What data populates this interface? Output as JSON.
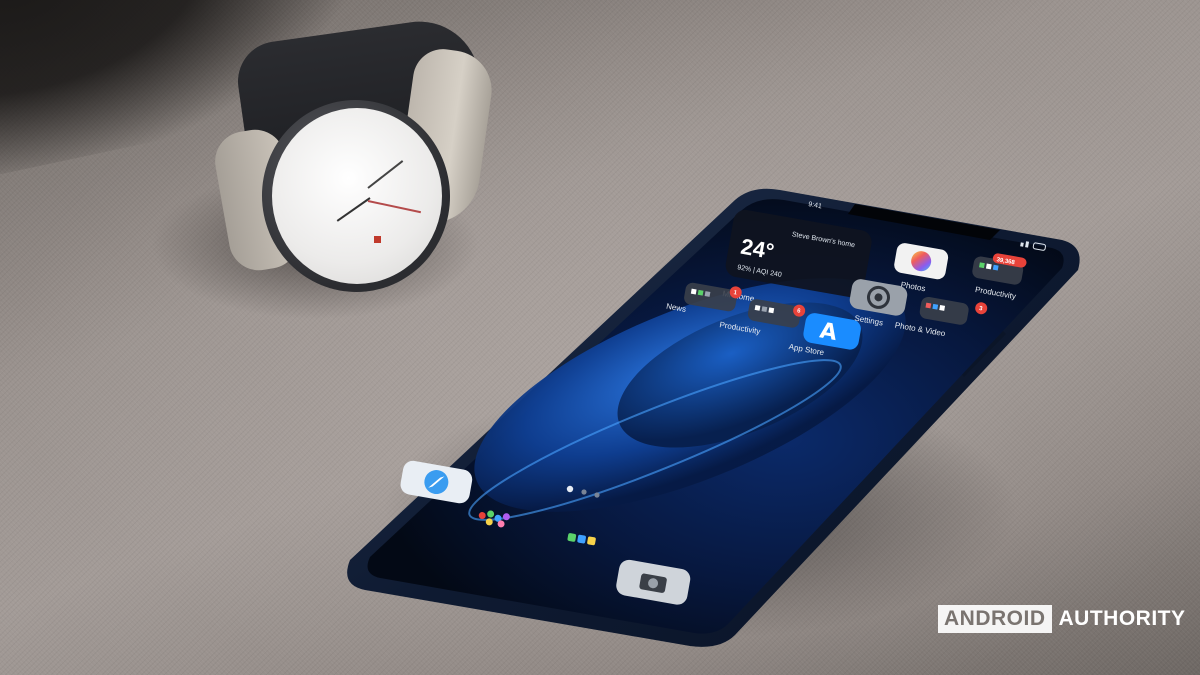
{
  "scene": {
    "description_icons": [
      "wristwatch-icon",
      "smartphone-icon"
    ],
    "colors": {
      "fabric": "#9b938f",
      "phone_frame": "#0d1a33",
      "wallpaper_blue": "#1f6fd6"
    }
  },
  "phone": {
    "status": {
      "time": "9:41"
    },
    "weather_widget": {
      "title": "Steve Brown's home",
      "temp": "24°",
      "detail": "92% | AQI 240"
    },
    "apps": [
      {
        "label": "Photos",
        "icon": "photos-icon"
      },
      {
        "label": "Productivity",
        "icon": "folder-icon",
        "badge": "39,368"
      },
      {
        "label": "Mi Home",
        "icon": "home-icon"
      },
      {
        "label": "News",
        "icon": "folder-icon",
        "badge": "1"
      },
      {
        "label": "Settings",
        "icon": "gear-icon"
      },
      {
        "label": "Photo & Video",
        "icon": "folder-icon",
        "badge": "3"
      },
      {
        "label": "Productivity",
        "icon": "folder-icon",
        "badge": "6"
      },
      {
        "label": "App Store",
        "icon": "app-store-icon"
      }
    ],
    "dock": [
      {
        "icon": "safari-icon"
      },
      {
        "icon": "folder-icon"
      },
      {
        "icon": "folder-icon"
      },
      {
        "icon": "camera-icon"
      }
    ]
  },
  "watermark": {
    "part1": "ANDROID",
    "part2": "AUTHORITY"
  }
}
